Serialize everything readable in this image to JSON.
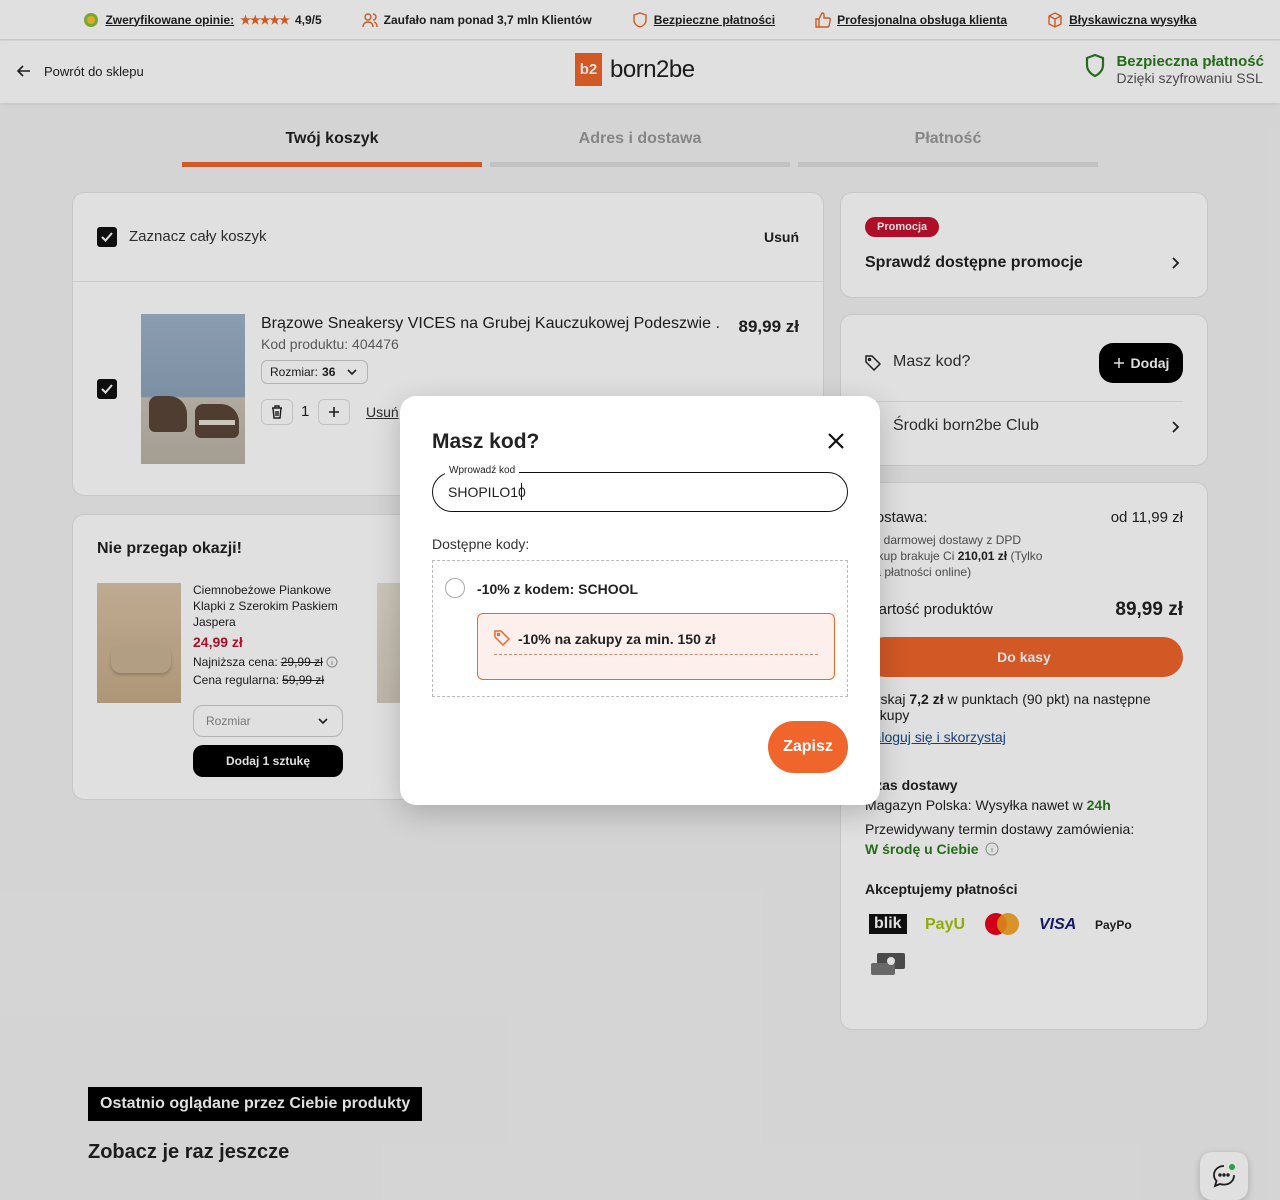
{
  "topbar": {
    "items": [
      {
        "label": "Zweryfikowane opinie:",
        "rating": "4,9/5"
      },
      {
        "label": "Zaufało nam ponad 3,7 mln Klientów"
      },
      {
        "label": "Bezpieczne płatności"
      },
      {
        "label": "Profesjonalna obsługa klienta"
      },
      {
        "label": "Błyskawiczna wysyłka"
      }
    ]
  },
  "header": {
    "back_label": "Powrót do sklepu",
    "logo_mark": "b2",
    "logo_text": "born2be",
    "secure_title": "Bezpieczna płatność",
    "secure_sub": "Dzięki szyfrowaniu SSL"
  },
  "steps": [
    {
      "label": "Twój koszyk",
      "active": true
    },
    {
      "label": "Adres i dostawa",
      "active": false
    },
    {
      "label": "Płatność",
      "active": false
    }
  ],
  "cart": {
    "select_all": "Zaznacz cały koszyk",
    "remove_all": "Usuń",
    "item": {
      "name": "Brązowe Sneakersy VICES na Grubej Kauczukowej Podeszwie ...",
      "code": "Kod produktu: 404476",
      "price": "89,99 zł",
      "size_label": "Rozmiar:",
      "size_value": "36",
      "quantity": "1",
      "remove": "Usuń"
    }
  },
  "deals": {
    "title": "Nie przegap okazji!",
    "product": {
      "name": "Ciemnobeżowe Piankowe Klapki z Szerokim Paskiem Jaspera",
      "price": "24,99 zł",
      "lowest_label": "Najniższa cena:",
      "lowest_value": "29,99 zł",
      "regular_label": "Cena regularna:",
      "regular_value": "59,99 zł",
      "size_placeholder": "Rozmiar",
      "add_button": "Dodaj 1 sztukę"
    }
  },
  "promo": {
    "badge": "Promocja",
    "title": "Sprawdź dostępne promocje"
  },
  "code_card": {
    "label": "Masz kod?",
    "add_button": "Dodaj",
    "club": "Środki born2be Club"
  },
  "summary": {
    "shipping_label": "Dostawa:",
    "shipping_value": "od 11,99 zł",
    "shipping_note_1": "Do darmowej dostawy z DPD",
    "shipping_note_2_pre": "zakup brakuje Ci",
    "shipping_note_2_bold": "210,01 zł",
    "shipping_note_2_post": "(Tylko",
    "shipping_note_3": "dla płatności online)",
    "products_label": "Wartość produktów",
    "products_value": "89,99 zł",
    "checkout": "Do kasy",
    "points_pre": "Zyskaj",
    "points_bold": "7,2 zł",
    "points_post": "w punktach (90 pkt) na następne",
    "points_line2": "zakupy",
    "login_link": "Zaloguj się i skorzystaj",
    "delivery_title": "Czas dostawy",
    "delivery_line_pre": "Magazyn Polska: Wysyłka nawet w",
    "delivery_line_bold": "24h",
    "delivery_term": "Przewidywany termin dostawy zamówienia:",
    "delivery_day": "W środę u Ciebie",
    "payments_title": "Akceptujemy płatności",
    "payments": [
      "blik",
      "PayU",
      "mastercard",
      "VISA",
      "PayPo"
    ]
  },
  "recent": {
    "tag": "Ostatnio oglądane przez Ciebie produkty",
    "title": "Zobacz je raz jeszcze"
  },
  "modal": {
    "title": "Masz kod?",
    "input_label": "Wprowadź kod",
    "input_value": "SHOPILO10",
    "available_label": "Dostępne kody:",
    "option_label": "-10% z kodem: SCHOOL",
    "option_detail": "-10% na zakupy za min. 150 zł",
    "save_button": "Zapisz"
  },
  "colors": {
    "brand_orange": "#f0652b",
    "price_red": "#c8102e",
    "secure_green": "#2c7a1f"
  }
}
